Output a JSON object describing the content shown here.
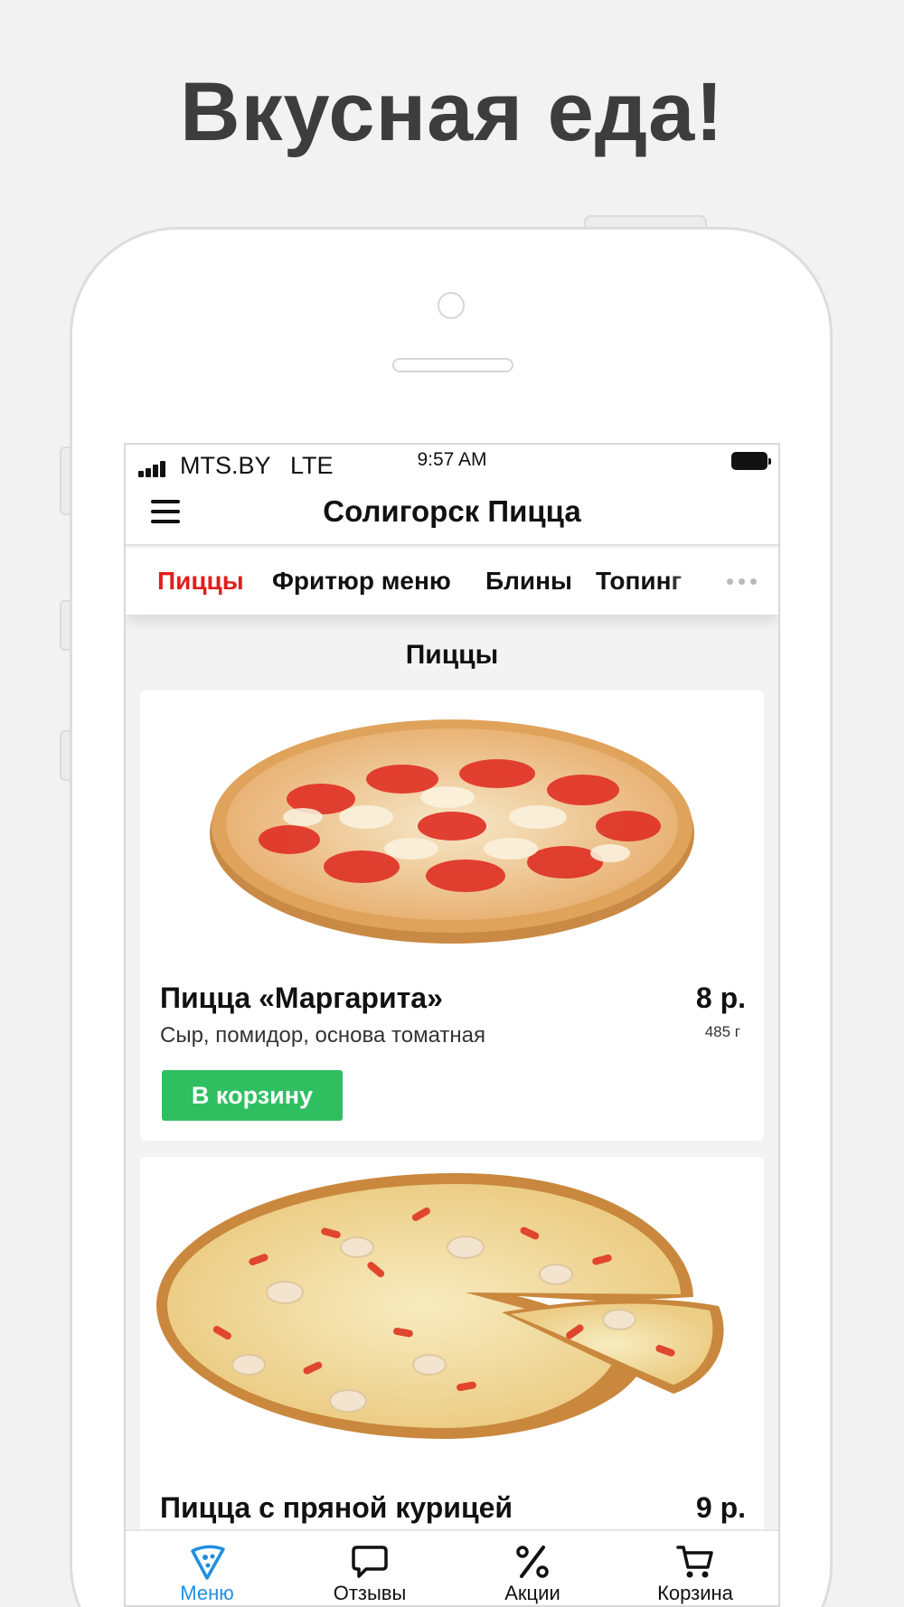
{
  "headline": "Вкусная еда!",
  "status_bar": {
    "carrier": "MTS.BY",
    "network": "LTE",
    "time": "9:57 AM"
  },
  "nav_bar": {
    "title": "Солигорск Пицца"
  },
  "categories": [
    {
      "label": "Пиццы",
      "active": true
    },
    {
      "label": "Фритюр меню",
      "active": false
    },
    {
      "label": "Блины",
      "active": false
    },
    {
      "label": "Топинг",
      "active": false
    }
  ],
  "section_title": "Пиццы",
  "dishes": [
    {
      "name": "Пицца «Маргарита»",
      "price": "8 р.",
      "description": "Сыр, помидор, основа томатная",
      "weight": "485 г",
      "button_label": "В корзину"
    },
    {
      "name": "Пицца с пряной курицей",
      "price": "9 р."
    }
  ],
  "tab_bar": [
    {
      "label": "Меню",
      "icon": "pizza-slice-icon",
      "active": true
    },
    {
      "label": "Отзывы",
      "icon": "chat-bubble-icon",
      "active": false
    },
    {
      "label": "Акции",
      "icon": "percent-icon",
      "active": false
    },
    {
      "label": "Корзина",
      "icon": "cart-icon",
      "active": false
    }
  ],
  "colors": {
    "accent_red": "#e21d1d",
    "button_green": "#2fbf61",
    "tab_active_blue": "#1f8fe0"
  }
}
